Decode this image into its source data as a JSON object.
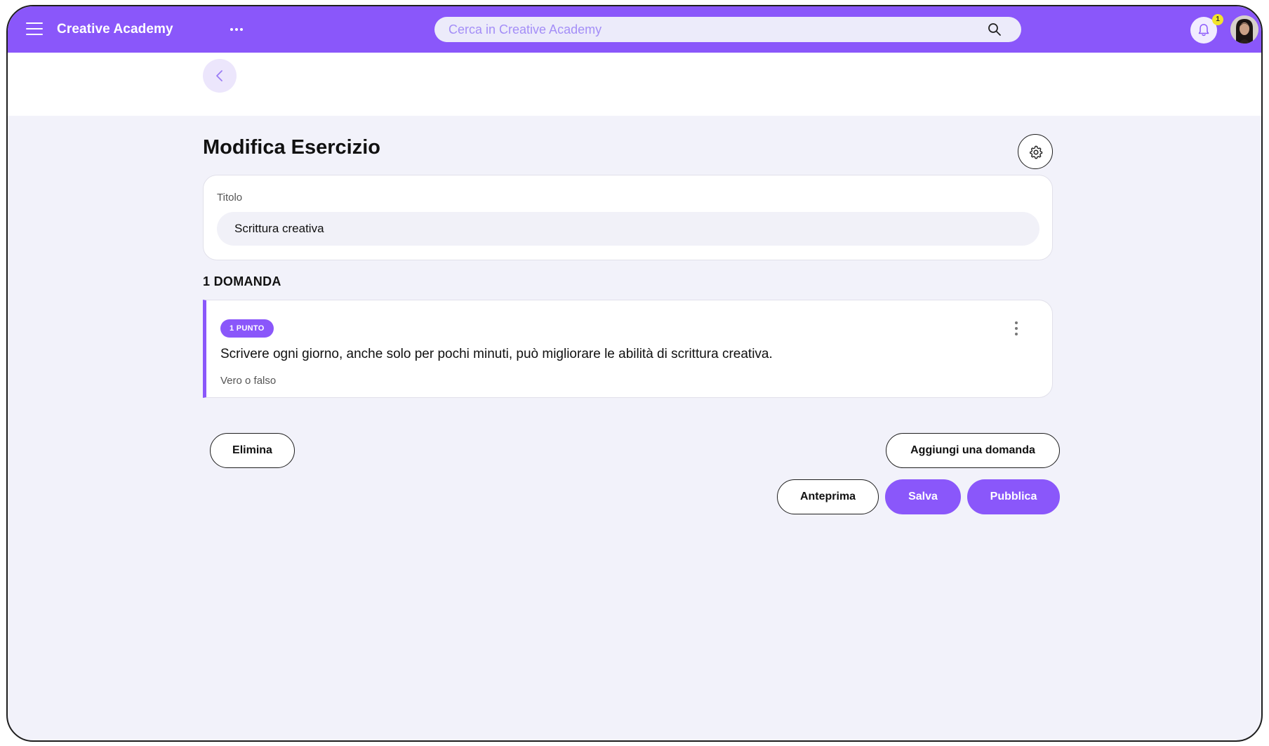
{
  "header": {
    "app_title": "Creative Academy",
    "search_placeholder": "Cerca in Creative Academy",
    "notification_count": "1"
  },
  "page": {
    "title": "Modifica Esercizio",
    "title_field": {
      "label": "Titolo",
      "value": "Scrittura creativa"
    },
    "question_count_heading": "1 DOMANDA",
    "questions": [
      {
        "points_badge": "1 PUNTO",
        "text": "Scrivere ogni giorno, anche solo per pochi minuti, può migliorare le abilità di scrittura creativa.",
        "type": "Vero o falso"
      }
    ]
  },
  "actions": {
    "delete_label": "Elimina",
    "add_question_label": "Aggiungi una domanda",
    "preview_label": "Anteprima",
    "save_label": "Salva",
    "publish_label": "Pubblica"
  },
  "colors": {
    "accent": "#8a57fa",
    "background": "#f2f2fa",
    "badge_yellow": "#f3e52a"
  },
  "icons": [
    "menu-icon",
    "more-horizontal-icon",
    "search-icon",
    "bell-icon",
    "chevron-left-icon",
    "gear-icon",
    "more-vertical-icon"
  ]
}
